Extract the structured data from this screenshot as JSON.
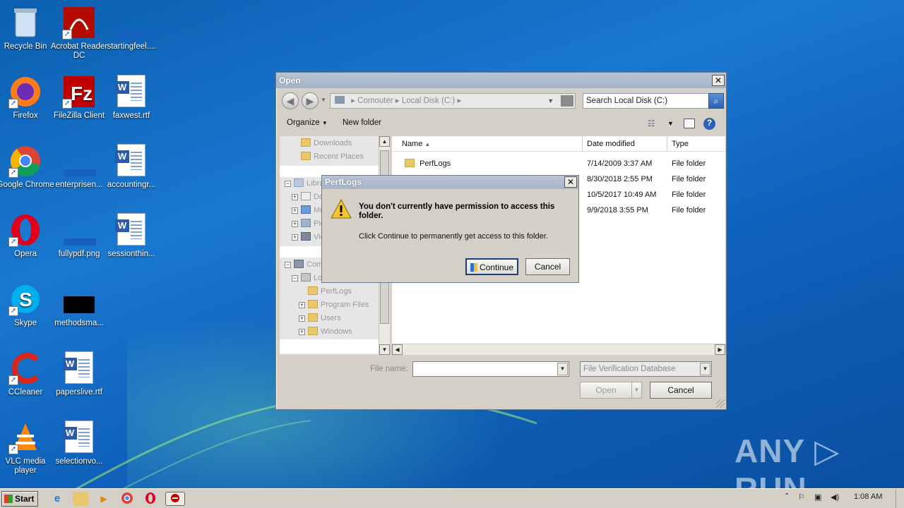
{
  "desktop": {
    "icons": [
      {
        "label": "Recycle Bin"
      },
      {
        "label": "Acrobat Reader DC"
      },
      {
        "label": "startingfeel...."
      },
      {
        "label": "Firefox"
      },
      {
        "label": "FileZilla Client"
      },
      {
        "label": "faxwest.rtf"
      },
      {
        "label": "Google Chrome"
      },
      {
        "label": "enterprisen..."
      },
      {
        "label": "accountingr..."
      },
      {
        "label": "Opera"
      },
      {
        "label": "fullypdf.png"
      },
      {
        "label": "sessionthin..."
      },
      {
        "label": "Skype"
      },
      {
        "label": "methodsma..."
      },
      {
        "label": "CCleaner"
      },
      {
        "label": "paperslive.rtf"
      },
      {
        "label": "VLC media player"
      },
      {
        "label": "selectionvo..."
      }
    ],
    "watermark": "ANY ▷ RUN"
  },
  "open_dialog": {
    "title": "Open",
    "close_label": "✕",
    "address": {
      "seg1": "Comouter",
      "seg2": "Local Disk (C:)"
    },
    "search_placeholder": "Search Local Disk (C:)",
    "toolbar": {
      "organize": "Organize",
      "new_folder": "New folder"
    },
    "tree": [
      {
        "label": "Downloads"
      },
      {
        "label": "Recent Places"
      },
      {
        "label": "Libra"
      },
      {
        "label": "Do"
      },
      {
        "label": "Mu"
      },
      {
        "label": "Pic"
      },
      {
        "label": "Vic"
      },
      {
        "label": "Com"
      },
      {
        "label": "Lo"
      },
      {
        "label": "PerfLogs"
      },
      {
        "label": "Program Files"
      },
      {
        "label": "Users"
      },
      {
        "label": "Windows"
      }
    ],
    "columns": {
      "name": "Name",
      "date": "Date modified",
      "type": "Type"
    },
    "rows": [
      {
        "name": "PerfLogs",
        "date": "7/14/2009 3:37 AM",
        "type": "File folder"
      },
      {
        "name": "",
        "date": "8/30/2018 2:55 PM",
        "type": "File folder"
      },
      {
        "name": "",
        "date": "10/5/2017 10:49 AM",
        "type": "File folder"
      },
      {
        "name": "",
        "date": "9/9/2018 3:55 PM",
        "type": "File folder"
      }
    ],
    "file_name_label": "File name:",
    "file_name_value": "",
    "file_type": "File Verification Database",
    "open_button": "Open",
    "cancel_button": "Cancel"
  },
  "permission_dialog": {
    "title": "PerfLogs",
    "close_label": "✕",
    "heading": "You don't currently have permission to access this folder.",
    "message": "Click Continue to permanently get access to this folder.",
    "continue_button": "Continue",
    "cancel_button": "Cancel"
  },
  "taskbar": {
    "start_label": "Start",
    "clock": "1:08 AM"
  },
  "colors": {
    "desktop_blue": "#1a78d0",
    "dialog_gray": "#d4d0c8",
    "warn_yellow": "#f4c430"
  }
}
